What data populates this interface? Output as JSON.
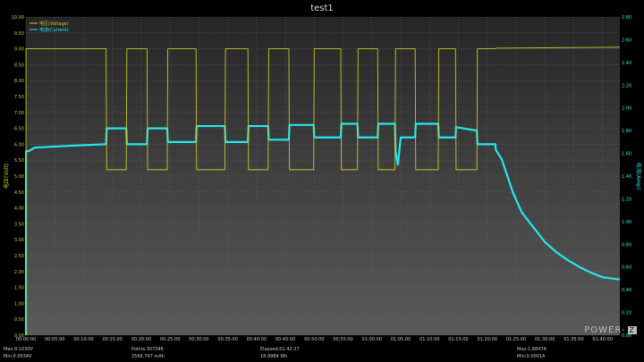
{
  "chart_data": {
    "type": "line",
    "title": "test1",
    "ylabel_left": "电压(Volt)",
    "ylabel_right": "电流(Amp)",
    "left_ticks": [
      "0.00",
      "0.50",
      "1.00",
      "1.50",
      "2.00",
      "2.50",
      "3.00",
      "3.50",
      "4.00",
      "4.50",
      "5.00",
      "5.50",
      "6.00",
      "6.50",
      "7.00",
      "7.50",
      "8.00",
      "8.50",
      "9.00",
      "9.50",
      "10.00"
    ],
    "right_ticks": [
      "0.00",
      "0.20",
      "0.40",
      "0.60",
      "0.80",
      "1.00",
      "1.20",
      "1.40",
      "1.60",
      "1.80",
      "2.00",
      "2.20",
      "2.40",
      "2.60",
      "2.80"
    ],
    "x_ticks": [
      "00:00:00",
      "00:05:00",
      "00:10:00",
      "00:15:00",
      "00:20:00",
      "00:25:00",
      "00:30:00",
      "00:35:00",
      "00:40:00",
      "00:45:00",
      "00:50:00",
      "00:55:00",
      "01:00:00",
      "01:05:00",
      "01:10:00",
      "01:15:00",
      "01:20:00",
      "01:25:00",
      "01:30:00",
      "01:35:00",
      "01:40:00"
    ],
    "ylim_left": [
      0,
      10
    ],
    "ylim_right": [
      0,
      2.8
    ],
    "xlim_minutes": [
      0,
      103
    ],
    "legend_position": "top-left",
    "grid": true,
    "series": [
      {
        "name": "电压(Voltage)",
        "color": "#c8c82a",
        "axis": "left",
        "x": [
          0,
          0.01,
          0.3,
          13.9,
          14.0,
          17.4,
          17.5,
          21.0,
          21.1,
          24.5,
          24.6,
          29.5,
          29.6,
          34.5,
          34.6,
          38.5,
          38.6,
          42.0,
          42.1,
          45.6,
          45.7,
          49.9,
          50.0,
          54.6,
          54.7,
          57.5,
          57.6,
          61.0,
          61.1,
          64.0,
          64.1,
          67.5,
          67.6,
          71.5,
          71.6,
          74.5,
          74.6,
          78.2,
          78.3,
          81.4,
          81.5,
          103
        ],
        "y": [
          0,
          9.0,
          9.0,
          9.0,
          5.2,
          5.2,
          9.0,
          9.0,
          5.2,
          5.2,
          9.0,
          9.0,
          5.2,
          5.2,
          9.0,
          9.0,
          5.2,
          5.2,
          9.0,
          9.0,
          5.2,
          5.2,
          9.0,
          9.0,
          5.2,
          5.2,
          9.0,
          9.0,
          5.2,
          5.2,
          9.0,
          9.0,
          5.2,
          5.2,
          9.0,
          9.0,
          5.2,
          5.2,
          9.0,
          9.0,
          9.02,
          9.05
        ]
      },
      {
        "name": "电流(Current)",
        "color": "#23e8ee",
        "axis": "right",
        "x": [
          0,
          0.01,
          0.5,
          1.5,
          5,
          9,
          13.9,
          14.0,
          17.4,
          17.5,
          21.0,
          21.1,
          24.5,
          24.6,
          29.5,
          29.6,
          34.5,
          34.6,
          38.5,
          38.6,
          42.0,
          42.1,
          45.6,
          45.7,
          49.9,
          50.0,
          54.6,
          54.7,
          57.5,
          57.6,
          61.0,
          61.1,
          64.0,
          64.1,
          64.5,
          65.0,
          67.5,
          67.6,
          71.5,
          71.6,
          74.5,
          74.6,
          78.2,
          78.3,
          80.0,
          81.4,
          81.5,
          82.5,
          83.5,
          84.5,
          86,
          88,
          90,
          92,
          94,
          96,
          98,
          100,
          103
        ],
        "y": [
          0,
          1.62,
          1.62,
          1.65,
          1.66,
          1.67,
          1.68,
          1.82,
          1.82,
          1.68,
          1.68,
          1.82,
          1.82,
          1.7,
          1.7,
          1.84,
          1.84,
          1.7,
          1.7,
          1.84,
          1.84,
          1.72,
          1.72,
          1.85,
          1.85,
          1.74,
          1.74,
          1.86,
          1.86,
          1.74,
          1.74,
          1.86,
          1.86,
          1.62,
          1.5,
          1.74,
          1.74,
          1.86,
          1.86,
          1.74,
          1.74,
          1.83,
          1.8,
          1.68,
          1.68,
          1.68,
          1.63,
          1.55,
          1.4,
          1.25,
          1.08,
          0.95,
          0.82,
          0.73,
          0.66,
          0.6,
          0.55,
          0.51,
          0.49
        ]
      }
    ]
  },
  "footer": {
    "max_voltage": "Max:9.1030V",
    "min_voltage": "Min:0.0034V",
    "points": "Points:307346",
    "capacity": "2566.747 mAh",
    "elapsed": "Elapsed:01:42:27",
    "energy": "18.9984 Wh",
    "max_current": "Max:1.8847A",
    "min_current": "Min:0.0001A"
  },
  "logo": {
    "text": "POWER-",
    "badge": "Z"
  },
  "colors": {
    "voltage": "#c8c82a",
    "current": "#23e8ee",
    "plot_top": "#2c2c2c",
    "plot_bottom": "#565656"
  }
}
